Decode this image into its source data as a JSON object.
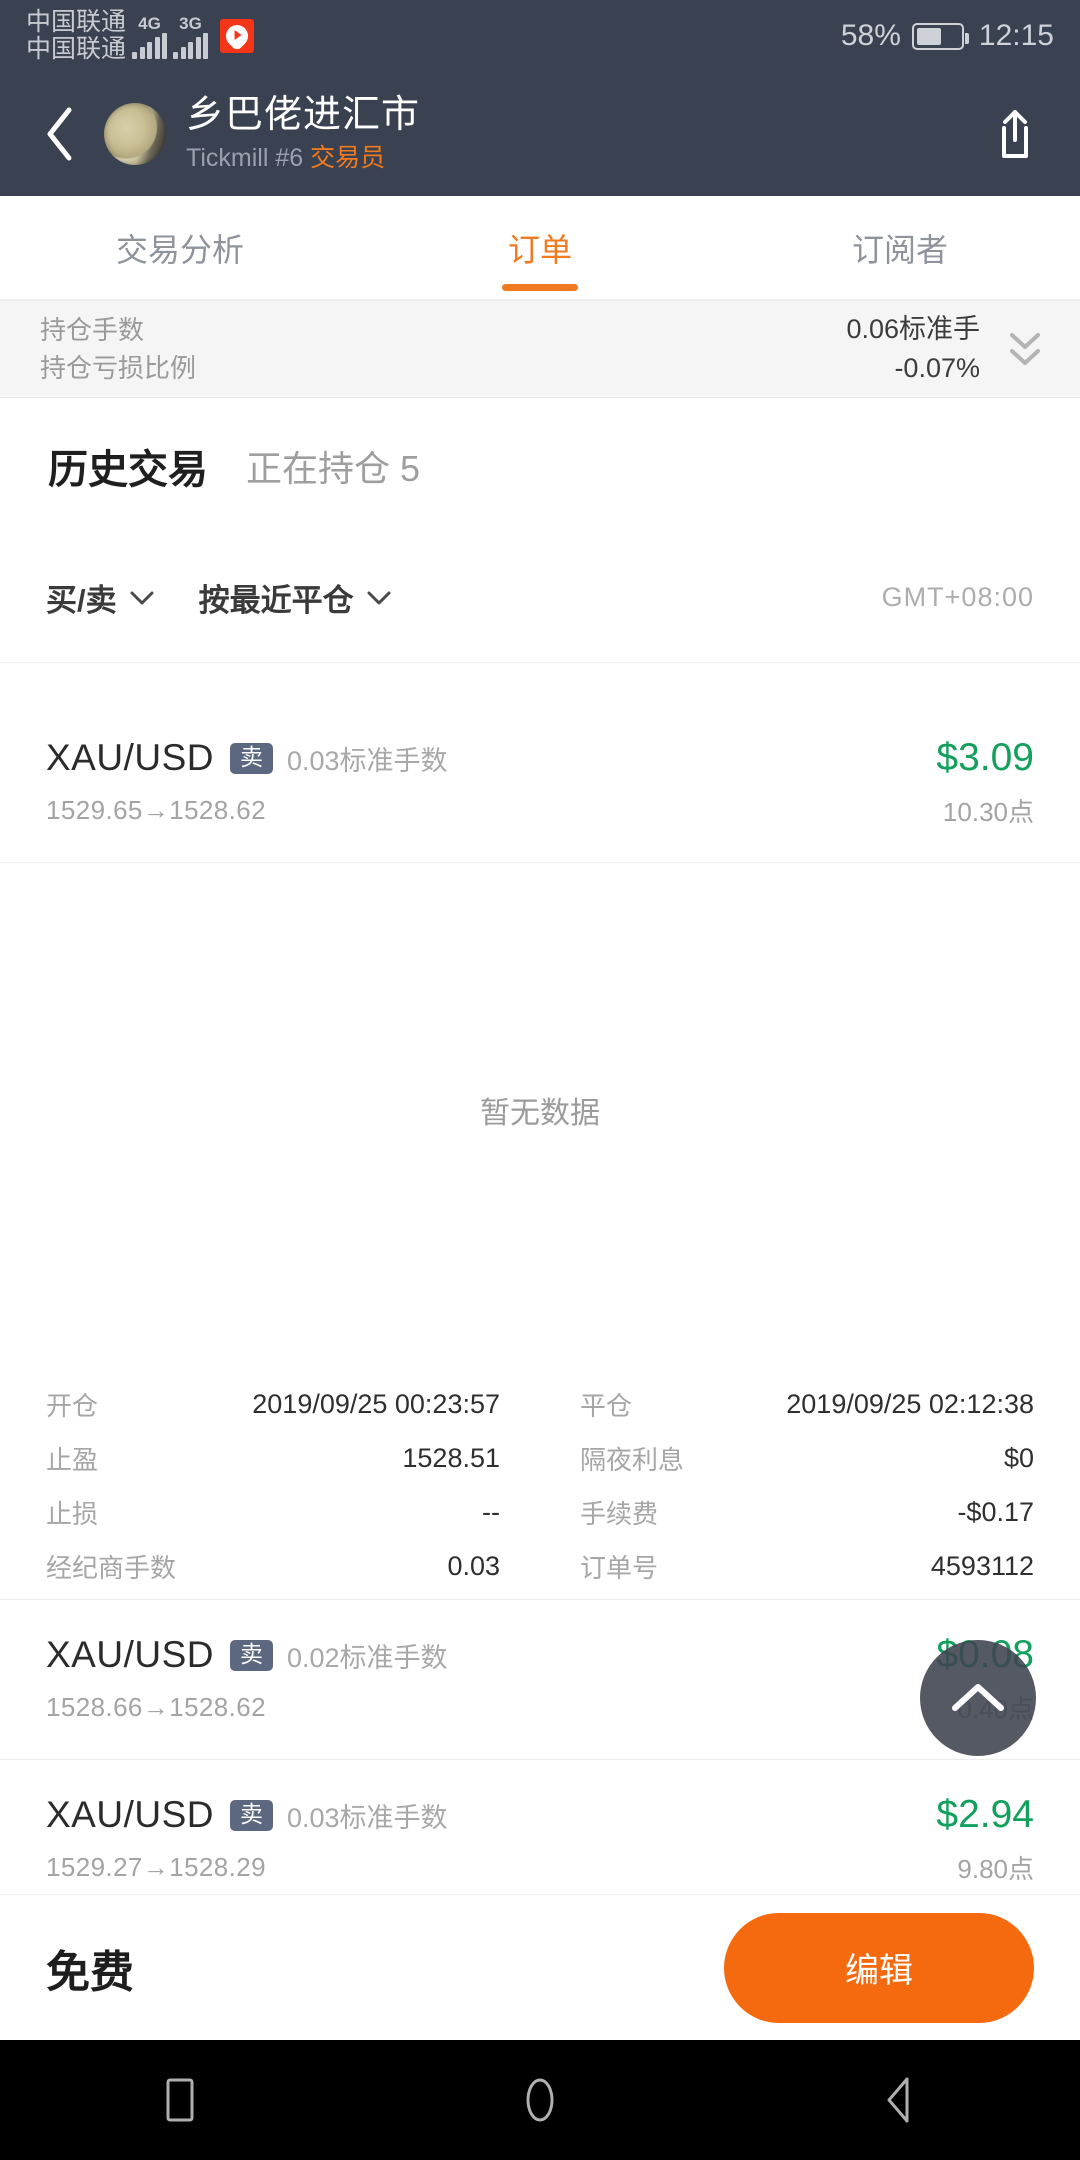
{
  "status_bar": {
    "carrier_1": "中国联通",
    "carrier_2": "中国联通",
    "network_1": "4G",
    "network_2": "3G",
    "battery_percent": "58%",
    "time": "12:15"
  },
  "header": {
    "trader_name": "乡巴佬进汇市",
    "broker_account": "Tickmill #6",
    "role_badge": "交易员"
  },
  "tabs": [
    {
      "label": "交易分析",
      "active": false
    },
    {
      "label": "订单",
      "active": true
    },
    {
      "label": "订阅者",
      "active": false
    }
  ],
  "summary": {
    "lots_label": "持仓手数",
    "lots_value": "0.06标准手",
    "loss_label": "持仓亏损比例",
    "loss_value": "-0.07%"
  },
  "subtabs": {
    "history_label": "历史交易",
    "open_label": "正在持仓 5"
  },
  "filters": {
    "side_label": "买/卖",
    "sort_label": "按最近平仓",
    "timezone": "GMT+08:00"
  },
  "empty_state": "暂无数据",
  "trades": [
    {
      "symbol": "XAU/USD",
      "side": "卖",
      "lots": "0.03标准手数",
      "open_price": "1529.65",
      "close_price": "1528.62",
      "arrow": "→",
      "profit": "$3.09",
      "points": "10.30点",
      "profit_positive": true
    },
    {
      "symbol": "XAU/USD",
      "side": "卖",
      "lots": "0.02标准手数",
      "open_price": "1528.66",
      "close_price": "1528.62",
      "arrow": "→",
      "profit": "$0.08",
      "points": "0.40点",
      "profit_positive": true
    },
    {
      "symbol": "XAU/USD",
      "side": "卖",
      "lots": "0.03标准手数",
      "open_price": "1529.27",
      "close_price": "1528.29",
      "arrow": "→",
      "profit": "$2.94",
      "points": "9.80点",
      "profit_positive": true
    }
  ],
  "detail": {
    "open_time_label": "开仓",
    "open_time_value": "2019/09/25 00:23:57",
    "close_time_label": "平仓",
    "close_time_value": "2019/09/25 02:12:38",
    "take_profit_label": "止盈",
    "take_profit_value": "1528.51",
    "swap_label": "隔夜利息",
    "swap_value": "$0",
    "stop_loss_label": "止损",
    "stop_loss_value": "--",
    "commission_label": "手续费",
    "commission_value": "-$0.17",
    "broker_lots_label": "经纪商手数",
    "broker_lots_value": "0.03",
    "order_id_label": "订单号",
    "order_id_value": "4593112"
  },
  "bottom_bar": {
    "price_label": "免费",
    "edit_button": "编辑"
  },
  "colors": {
    "header_bg": "#3a4150",
    "accent_orange": "#f07a20",
    "button_orange": "#f56a0f",
    "profit_green": "#13a05c",
    "badge_blue_gray": "#5b6880"
  }
}
